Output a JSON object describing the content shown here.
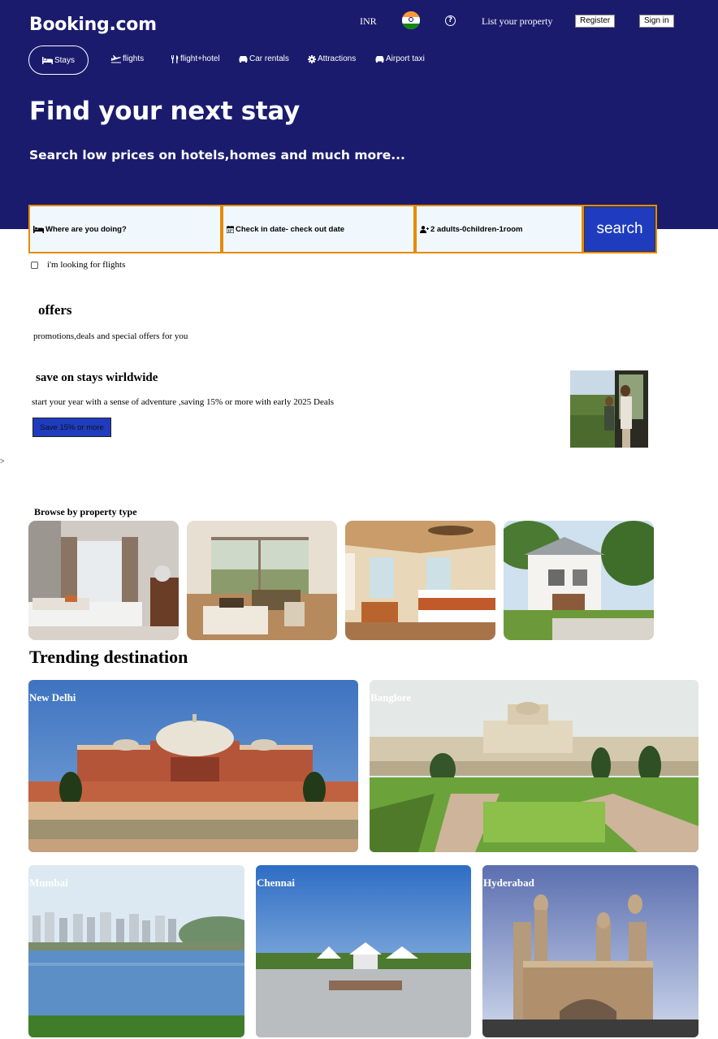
{
  "header": {
    "logo": "Booking.com",
    "currency": "INR",
    "flag_icon": "india-flag-icon",
    "help_icon": "?",
    "list_property": "List your property",
    "register": "Register",
    "signin": "Sign in"
  },
  "categories": [
    {
      "label": "Stays",
      "icon": "bed-icon"
    },
    {
      "label": "flights",
      "icon": "plane-icon"
    },
    {
      "label": "flight+hotel",
      "icon": "utensils-icon"
    },
    {
      "label": "Car rentals",
      "icon": "car-icon"
    },
    {
      "label": "Attractions",
      "icon": "gear-icon"
    },
    {
      "label": "Airport taxi",
      "icon": "taxi-icon"
    }
  ],
  "hero": {
    "title": "Find your next stay",
    "subtitle": "Search low prices on hotels,homes and much more..."
  },
  "search": {
    "destination": "Where are you doing?",
    "dates": "Check in date- check out date",
    "guests": "2 adults-0children-1room",
    "button": "search"
  },
  "flights_checkbox": {
    "label": "i'm looking for flights",
    "checked": false
  },
  "offers": {
    "title": "offers",
    "subtitle": "promotions,deals and special offers for you",
    "card_title": "save on stays wirldwide",
    "card_text": "start your year with a sense of adventure ,saving 15% or more with early 2025 Deals",
    "card_button": "Save 15% or more"
  },
  "stray_text": ">",
  "browse": {
    "title": "Browse by property type"
  },
  "trending": {
    "title": "Trending destination",
    "destinations": [
      "New Delhi",
      "Banglore",
      "Mumbai",
      "Chennai",
      "Hyderabad"
    ]
  },
  "colors": {
    "hero_bg": "#1b1b6e",
    "search_border": "#e68a00",
    "search_button": "#1f3cbf",
    "field_bg": "#f0f8fd"
  }
}
